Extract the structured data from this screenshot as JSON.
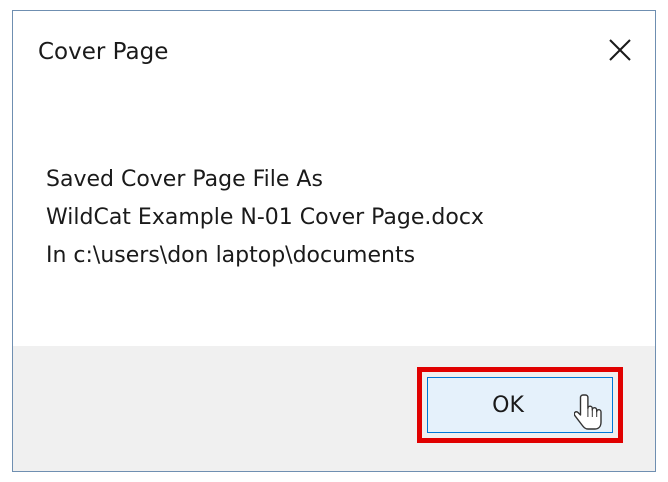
{
  "window": {
    "title": "Cover Page",
    "close_icon": "close-icon"
  },
  "message": {
    "lines": [
      "Saved Cover Page File As",
      "WildCat Example N-01 Cover Page.docx",
      "In c:\\users\\don laptop\\documents"
    ]
  },
  "footer": {
    "ok_label": "OK"
  },
  "colors": {
    "highlight": "#e00000",
    "button_fill": "#e5f1fb",
    "button_border": "#0078d7",
    "footer_background": "#f0f0f0",
    "window_border": "#6f8fb1"
  },
  "icons": {
    "cursor": "hand-pointer-cursor-icon"
  }
}
